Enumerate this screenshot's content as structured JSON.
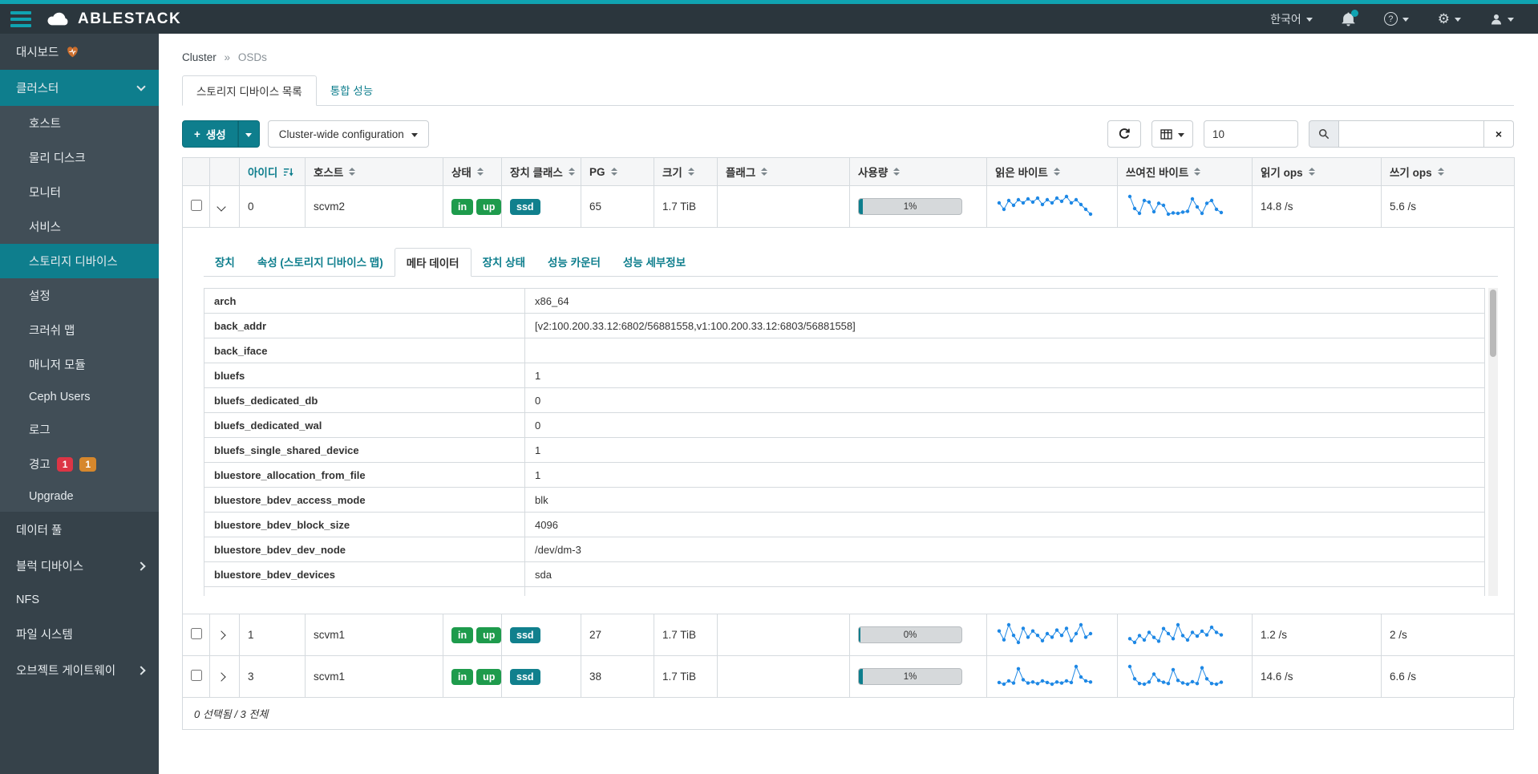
{
  "colors": {
    "accent": "#0e7e8d",
    "topbar_strip": "#10a3b1",
    "success_badge": "#1e9b4c",
    "class_badge": "#11808d",
    "sparkline": "#1e88e5",
    "alert_danger": "#dc3545",
    "alert_warning": "#d6872c"
  },
  "topbar": {
    "brand": "ABLESTACK",
    "language_label": "한국어"
  },
  "sidebar": {
    "dashboard": "대시보드",
    "cluster": "클러스터",
    "cluster_items": [
      "호스트",
      "물리 디스크",
      "모니터",
      "서비스",
      "스토리지 디바이스",
      "설정",
      "크러쉬 맵",
      "매니저 모듈",
      "Ceph Users",
      "로그",
      "경고",
      "Upgrade"
    ],
    "alert_badge_danger": "1",
    "alert_badge_warning": "1",
    "items_bottom": [
      "데이터 풀",
      "블럭 디바이스",
      "NFS",
      "파일 시스템",
      "오브젝트 게이트웨이"
    ]
  },
  "breadcrumb": {
    "section": "Cluster",
    "separator": "»",
    "page": "OSDs"
  },
  "tabs": [
    {
      "label": "스토리지 디바이스 목록"
    },
    {
      "label": "통합 성능"
    }
  ],
  "toolbar": {
    "create_label": "생성",
    "cluster_wide_label": "Cluster-wide configuration",
    "page_size": "10",
    "search_value": ""
  },
  "table": {
    "headers": [
      "아이디",
      "호스트",
      "상태",
      "장치 클래스",
      "PG",
      "크기",
      "플래그",
      "사용량",
      "읽은 바이트",
      "쓰여진 바이트",
      "읽기 ops",
      "쓰기 ops"
    ],
    "rows": [
      {
        "id": "0",
        "host": "scvm2",
        "status": [
          "in",
          "up"
        ],
        "device_class": "ssd",
        "pg": "65",
        "size": "1.7 TiB",
        "flags": "",
        "usage_label": "1%",
        "usage_pct": 1,
        "read_ops": "14.8 /s",
        "write_ops": "5.6 /s",
        "read_spark": [
          52,
          44,
          55,
          49,
          56,
          52,
          57,
          53,
          58,
          50,
          56,
          52,
          58,
          54,
          60,
          52,
          56,
          50,
          44,
          38
        ],
        "write_spark": [
          72,
          42,
          30,
          62,
          58,
          34,
          55,
          50,
          28,
          31,
          30,
          33,
          35,
          66,
          46,
          30,
          55,
          62,
          40,
          32
        ]
      },
      {
        "id": "1",
        "host": "scvm1",
        "status": [
          "in",
          "up"
        ],
        "device_class": "ssd",
        "pg": "27",
        "size": "1.7 TiB",
        "flags": "",
        "usage_label": "0%",
        "usage_pct": 0,
        "read_ops": "1.2 /s",
        "write_ops": "2 /s",
        "read_spark": [
          55,
          45,
          62,
          50,
          42,
          58,
          48,
          55,
          50,
          44,
          52,
          48,
          56,
          50,
          58,
          44,
          52,
          62,
          48,
          52
        ],
        "write_spark": [
          40,
          34,
          45,
          38,
          50,
          42,
          36,
          56,
          48,
          40,
          62,
          45,
          38,
          50,
          44,
          52,
          46,
          58,
          50,
          46
        ]
      },
      {
        "id": "3",
        "host": "scvm1",
        "status": [
          "in",
          "up"
        ],
        "device_class": "ssd",
        "pg": "38",
        "size": "1.7 TiB",
        "flags": "",
        "usage_label": "1%",
        "usage_pct": 1,
        "read_ops": "14.6 /s",
        "write_ops": "6.6 /s",
        "read_spark": [
          45,
          42,
          48,
          44,
          70,
          50,
          44,
          46,
          43,
          48,
          45,
          42,
          46,
          44,
          48,
          45,
          74,
          55,
          48,
          46
        ],
        "write_spark": [
          84,
          45,
          30,
          28,
          35,
          60,
          40,
          34,
          30,
          74,
          40,
          32,
          28,
          36,
          30,
          80,
          45,
          30,
          28,
          34
        ]
      }
    ],
    "footer": "0 선택됨 / 3 전체"
  },
  "detail": {
    "tabs": [
      "장치",
      "속성 (스토리지 디바이스 맵)",
      "메타 데이터",
      "장치 상태",
      "성능 카운터",
      "성능 세부정보"
    ],
    "metadata": [
      {
        "key": "arch",
        "value": "x86_64"
      },
      {
        "key": "back_addr",
        "value": "[v2:100.200.33.12:6802/56881558,v1:100.200.33.12:6803/56881558]"
      },
      {
        "key": "back_iface",
        "value": ""
      },
      {
        "key": "bluefs",
        "value": "1"
      },
      {
        "key": "bluefs_dedicated_db",
        "value": "0"
      },
      {
        "key": "bluefs_dedicated_wal",
        "value": "0"
      },
      {
        "key": "bluefs_single_shared_device",
        "value": "1"
      },
      {
        "key": "bluestore_allocation_from_file",
        "value": "1"
      },
      {
        "key": "bluestore_bdev_access_mode",
        "value": "blk"
      },
      {
        "key": "bluestore_bdev_block_size",
        "value": "4096"
      },
      {
        "key": "bluestore_bdev_dev_node",
        "value": "/dev/dm-3"
      },
      {
        "key": "bluestore_bdev_devices",
        "value": "sda"
      }
    ]
  }
}
